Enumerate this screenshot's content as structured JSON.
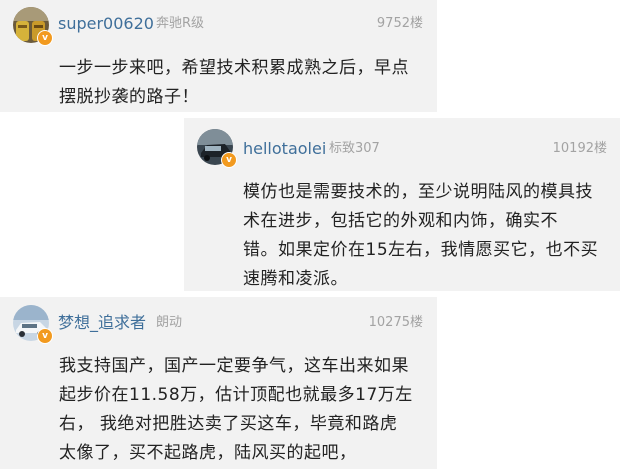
{
  "posts": [
    {
      "username": "super00620",
      "level": "奔驰R级",
      "floor": "9752楼",
      "badge": "v",
      "content_lines": [
        "一步一步来吧，希望技术积累成熟之后，早点",
        "摆脱抄袭的路子！"
      ]
    },
    {
      "username": "hellotaolei",
      "level": "标致307",
      "floor": "10192楼",
      "badge": "v",
      "content_lines": [
        "模仿也是需要技术的，至少说明陆风的模具技",
        "术在进步，包括它的外观和内饰，确实不",
        "错。如果定价在15左右，我情愿买它，也不买",
        "速腾和凌派。"
      ]
    },
    {
      "username": "梦想_追求者",
      "level": "朗动",
      "floor": "10275楼",
      "badge": "v",
      "content_lines": [
        "我支持国产，国产一定要争气，这车出来如果",
        "起步价在11.58万，估计顶配也就最多17万左",
        "右，  我绝对把胜达卖了买这车，毕竟和路虎",
        "太像了，买不起路虎，陆风买的起吧，"
      ]
    }
  ],
  "colors": {
    "card_bg": "#f2f2f2",
    "username": "#3f6f9a",
    "meta": "#a3a3a3",
    "text": "#222222",
    "badge": "#f29a1f"
  }
}
